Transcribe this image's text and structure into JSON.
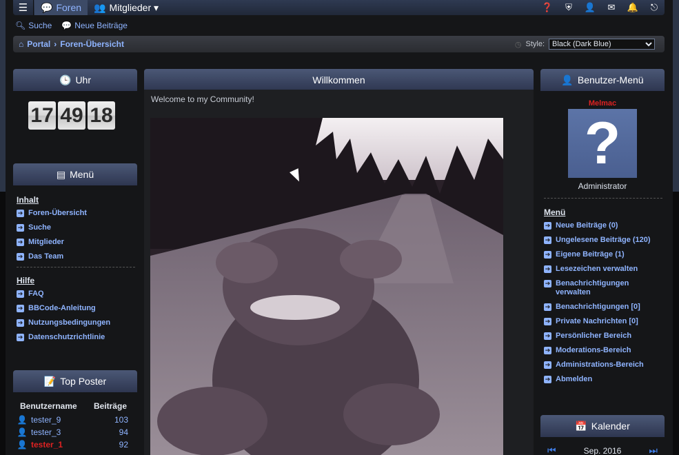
{
  "topnav": {
    "tabs": [
      {
        "label": "Foren",
        "icon": "chat-bubble-icon",
        "active": true
      },
      {
        "label": "Mitglieder ▾",
        "icon": "users-icon",
        "active": false
      }
    ],
    "right_icons": [
      "help-icon",
      "shield-icon",
      "user-icon",
      "mail-icon",
      "bell-icon",
      "logout-icon"
    ]
  },
  "subnav": {
    "search_label": "Suche",
    "new_posts_label": "Neue Beiträge"
  },
  "breadcrumb": {
    "portal": "Portal",
    "overview": "Foren-Übersicht",
    "style_label": "Style:",
    "style_value": "Black (Dark Blue)"
  },
  "clock": {
    "title": "Uhr",
    "hours": "17",
    "minutes": "49",
    "seconds": "18"
  },
  "menu": {
    "title": "Menü",
    "content_title": "Inhalt",
    "content_items": [
      "Foren-Übersicht",
      "Suche",
      "Mitglieder",
      "Das Team"
    ],
    "help_title": "Hilfe",
    "help_items": [
      "FAQ",
      "BBCode-Anleitung",
      "Nutzungsbedingungen",
      "Datenschutzrichtlinie"
    ]
  },
  "top_poster": {
    "title": "Top Poster",
    "col_user": "Benutzername",
    "col_posts": "Beiträge",
    "rows": [
      {
        "name": "tester_9",
        "posts": "103",
        "admin": false
      },
      {
        "name": "tester_3",
        "posts": "94",
        "admin": false
      },
      {
        "name": "tester_1",
        "posts": "92",
        "admin": true
      }
    ]
  },
  "welcome": {
    "title": "Willkommen",
    "text": "Welcome to my Community!"
  },
  "user_menu": {
    "title": "Benutzer-Menü",
    "username": "Melmac",
    "role": "Administrator",
    "menu_title": "Menü",
    "items": [
      "Neue Beiträge (0)",
      "Ungelesene Beiträge (120)",
      "Eigene Beiträge (1)",
      "Lesezeichen verwalten",
      "Benachrichtigungen verwalten",
      "Benachrichtigungen [0]",
      "Private Nachrichten [0]",
      "Persönlicher Bereich",
      "Moderations-Bereich",
      "Administrations-Bereich",
      "Abmelden"
    ]
  },
  "calendar": {
    "title": "Kalender",
    "month": "Sep. 2016"
  },
  "colors": {
    "link": "#8fb4ff",
    "admin_name": "#dd2222",
    "header_gradient_top": "#4b5876"
  }
}
